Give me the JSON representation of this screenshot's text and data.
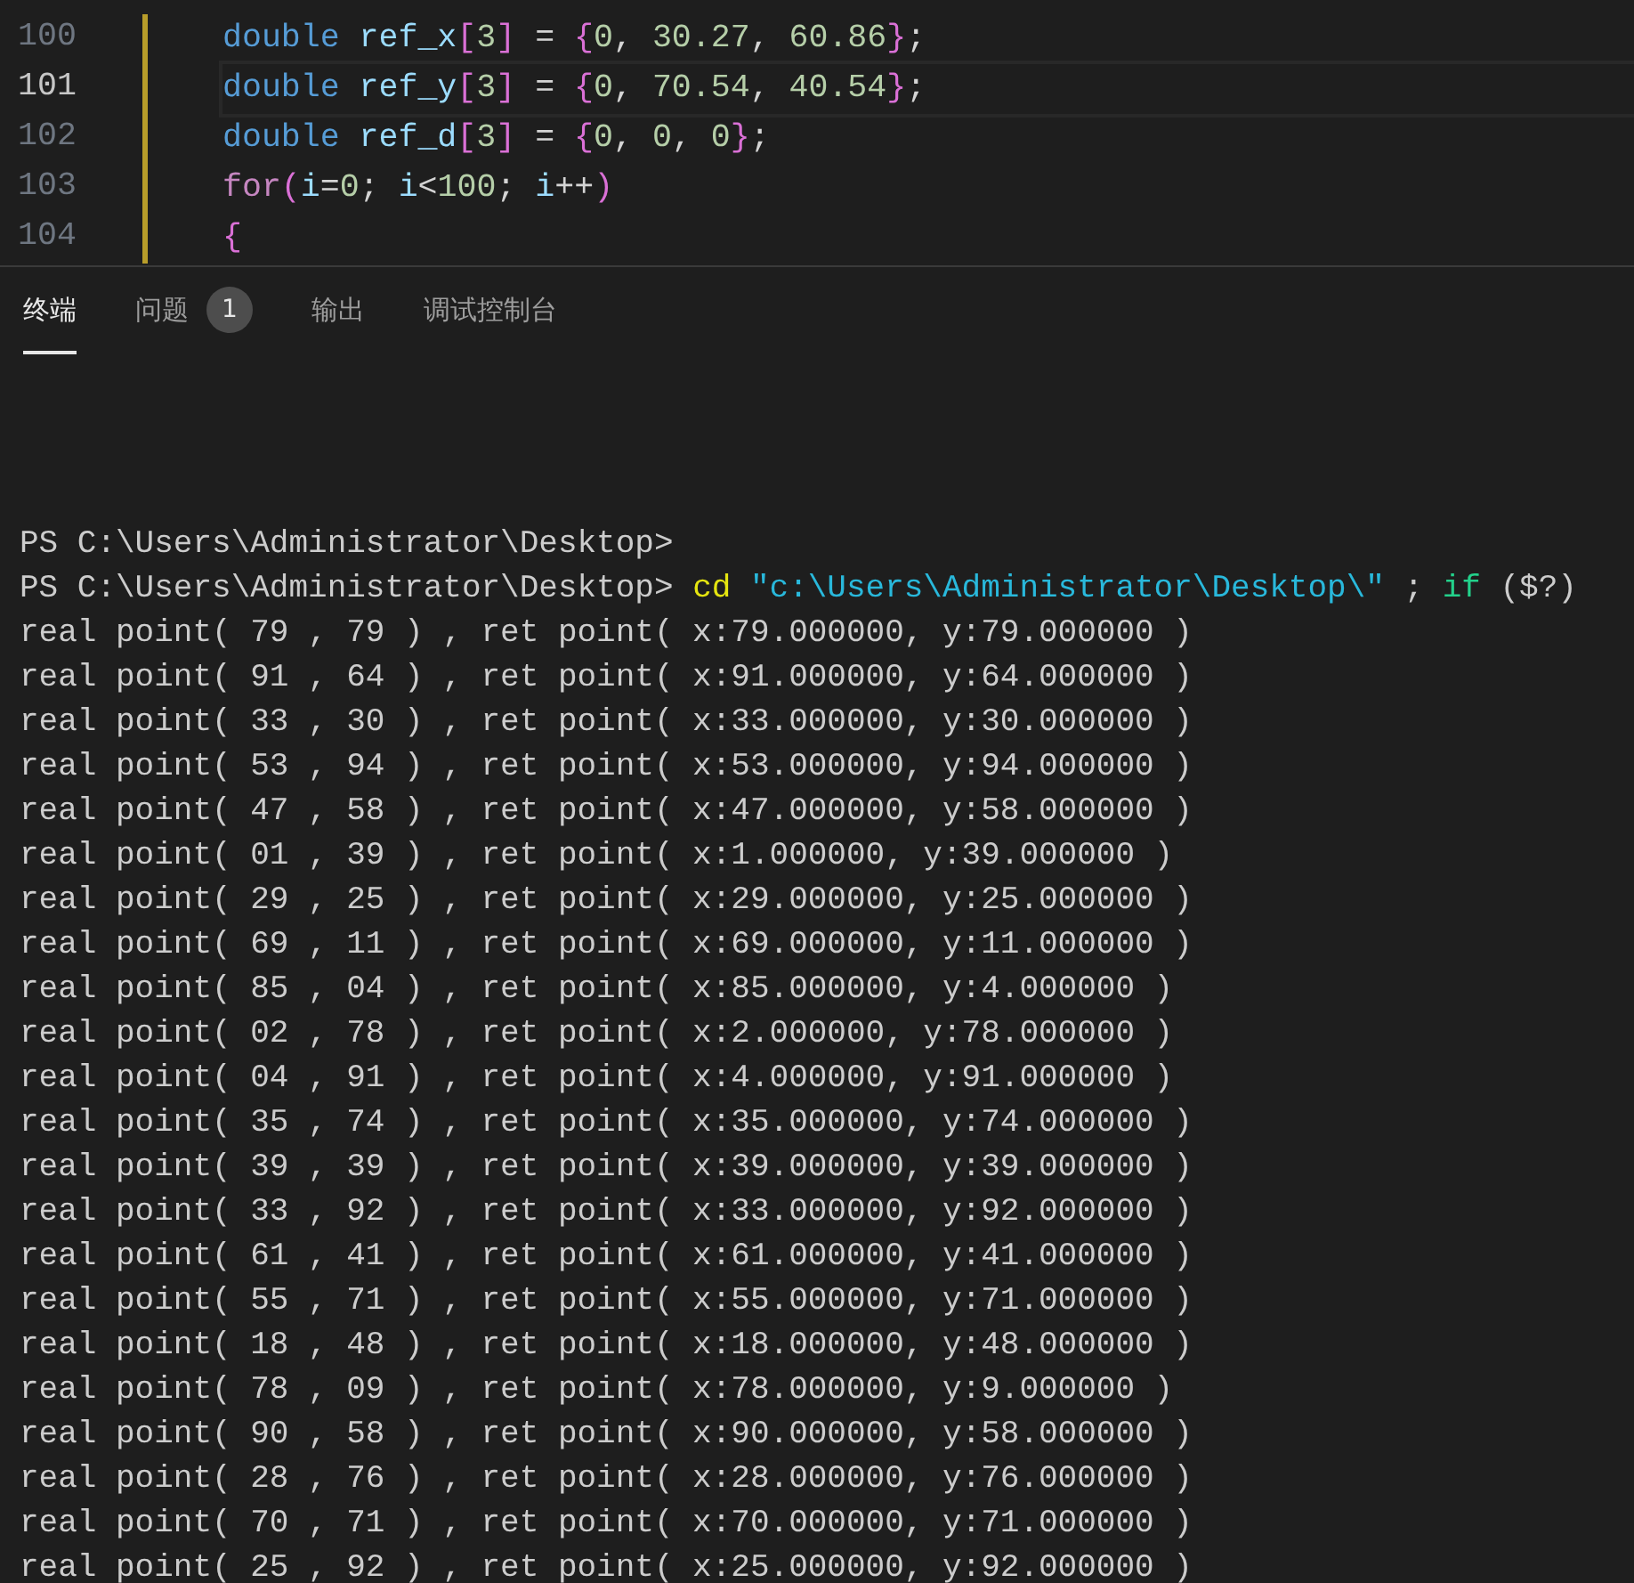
{
  "editor": {
    "lines": [
      {
        "number": "100",
        "current": false,
        "tokens": [
          {
            "kind": "type",
            "text": "double "
          },
          {
            "kind": "variable",
            "text": "ref_x"
          },
          {
            "kind": "bracket",
            "text": "["
          },
          {
            "kind": "number",
            "text": "3"
          },
          {
            "kind": "bracket",
            "text": "]"
          },
          {
            "kind": "plain",
            "text": " = "
          },
          {
            "kind": "bracket",
            "text": "{"
          },
          {
            "kind": "number",
            "text": "0"
          },
          {
            "kind": "plain",
            "text": ", "
          },
          {
            "kind": "number",
            "text": "30.27"
          },
          {
            "kind": "plain",
            "text": ", "
          },
          {
            "kind": "number",
            "text": "60.86"
          },
          {
            "kind": "bracket",
            "text": "}"
          },
          {
            "kind": "plain",
            "text": ";"
          }
        ]
      },
      {
        "number": "101",
        "current": true,
        "tokens": [
          {
            "kind": "type",
            "text": "double "
          },
          {
            "kind": "variable",
            "text": "ref_y"
          },
          {
            "kind": "bracket",
            "text": "["
          },
          {
            "kind": "number",
            "text": "3"
          },
          {
            "kind": "bracket",
            "text": "]"
          },
          {
            "kind": "plain",
            "text": " = "
          },
          {
            "kind": "bracket",
            "text": "{"
          },
          {
            "kind": "number",
            "text": "0"
          },
          {
            "kind": "plain",
            "text": ", "
          },
          {
            "kind": "number",
            "text": "70.54"
          },
          {
            "kind": "plain",
            "text": ", "
          },
          {
            "kind": "number",
            "text": "40.54"
          },
          {
            "kind": "bracket",
            "text": "}"
          },
          {
            "kind": "plain",
            "text": ";"
          }
        ]
      },
      {
        "number": "102",
        "current": false,
        "tokens": [
          {
            "kind": "type",
            "text": "double "
          },
          {
            "kind": "variable",
            "text": "ref_d"
          },
          {
            "kind": "bracket",
            "text": "["
          },
          {
            "kind": "number",
            "text": "3"
          },
          {
            "kind": "bracket",
            "text": "]"
          },
          {
            "kind": "plain",
            "text": " = "
          },
          {
            "kind": "bracket",
            "text": "{"
          },
          {
            "kind": "number",
            "text": "0"
          },
          {
            "kind": "plain",
            "text": ", "
          },
          {
            "kind": "number",
            "text": "0"
          },
          {
            "kind": "plain",
            "text": ", "
          },
          {
            "kind": "number",
            "text": "0"
          },
          {
            "kind": "bracket",
            "text": "}"
          },
          {
            "kind": "plain",
            "text": ";"
          }
        ]
      },
      {
        "number": "103",
        "current": false,
        "tokens": [
          {
            "kind": "keyword",
            "text": "for"
          },
          {
            "kind": "bracket",
            "text": "("
          },
          {
            "kind": "variable",
            "text": "i"
          },
          {
            "kind": "plain",
            "text": "="
          },
          {
            "kind": "number",
            "text": "0"
          },
          {
            "kind": "plain",
            "text": "; "
          },
          {
            "kind": "variable",
            "text": "i"
          },
          {
            "kind": "plain",
            "text": "<"
          },
          {
            "kind": "number",
            "text": "100"
          },
          {
            "kind": "plain",
            "text": "; "
          },
          {
            "kind": "variable",
            "text": "i"
          },
          {
            "kind": "plain",
            "text": "++"
          },
          {
            "kind": "bracket",
            "text": ")"
          }
        ]
      },
      {
        "number": "104",
        "current": false,
        "tokens": [
          {
            "kind": "bracket",
            "text": "{"
          }
        ]
      }
    ]
  },
  "panel": {
    "tabs": [
      {
        "label": "终端",
        "selected": true
      },
      {
        "label": "问题",
        "selected": false,
        "badge": "1"
      },
      {
        "label": "输出",
        "selected": false
      },
      {
        "label": "调试控制台",
        "selected": false
      }
    ]
  },
  "terminal": {
    "lines": [
      [
        {
          "kind": "plain",
          "text": "PS C:\\Users\\Administrator\\Desktop>"
        }
      ],
      [
        {
          "kind": "plain",
          "text": "PS C:\\Users\\Administrator\\Desktop> "
        },
        {
          "kind": "command",
          "text": "cd "
        },
        {
          "kind": "string",
          "text": "\"c:\\Users\\Administrator\\Desktop\\\""
        },
        {
          "kind": "plain",
          "text": " ; "
        },
        {
          "kind": "keyword",
          "text": "if"
        },
        {
          "kind": "plain",
          "text": " ($?)"
        }
      ],
      [
        {
          "kind": "plain",
          "text": "real point( 79 , 79 ) , ret point( x:79.000000, y:79.000000 )"
        }
      ],
      [
        {
          "kind": "plain",
          "text": "real point( 91 , 64 ) , ret point( x:91.000000, y:64.000000 )"
        }
      ],
      [
        {
          "kind": "plain",
          "text": "real point( 33 , 30 ) , ret point( x:33.000000, y:30.000000 )"
        }
      ],
      [
        {
          "kind": "plain",
          "text": "real point( 53 , 94 ) , ret point( x:53.000000, y:94.000000 )"
        }
      ],
      [
        {
          "kind": "plain",
          "text": "real point( 47 , 58 ) , ret point( x:47.000000, y:58.000000 )"
        }
      ],
      [
        {
          "kind": "plain",
          "text": "real point( 01 , 39 ) , ret point( x:1.000000, y:39.000000 )"
        }
      ],
      [
        {
          "kind": "plain",
          "text": "real point( 29 , 25 ) , ret point( x:29.000000, y:25.000000 )"
        }
      ],
      [
        {
          "kind": "plain",
          "text": "real point( 69 , 11 ) , ret point( x:69.000000, y:11.000000 )"
        }
      ],
      [
        {
          "kind": "plain",
          "text": "real point( 85 , 04 ) , ret point( x:85.000000, y:4.000000 )"
        }
      ],
      [
        {
          "kind": "plain",
          "text": "real point( 02 , 78 ) , ret point( x:2.000000, y:78.000000 )"
        }
      ],
      [
        {
          "kind": "plain",
          "text": "real point( 04 , 91 ) , ret point( x:4.000000, y:91.000000 )"
        }
      ],
      [
        {
          "kind": "plain",
          "text": "real point( 35 , 74 ) , ret point( x:35.000000, y:74.000000 )"
        }
      ],
      [
        {
          "kind": "plain",
          "text": "real point( 39 , 39 ) , ret point( x:39.000000, y:39.000000 )"
        }
      ],
      [
        {
          "kind": "plain",
          "text": "real point( 33 , 92 ) , ret point( x:33.000000, y:92.000000 )"
        }
      ],
      [
        {
          "kind": "plain",
          "text": "real point( 61 , 41 ) , ret point( x:61.000000, y:41.000000 )"
        }
      ],
      [
        {
          "kind": "plain",
          "text": "real point( 55 , 71 ) , ret point( x:55.000000, y:71.000000 )"
        }
      ],
      [
        {
          "kind": "plain",
          "text": "real point( 18 , 48 ) , ret point( x:18.000000, y:48.000000 )"
        }
      ],
      [
        {
          "kind": "plain",
          "text": "real point( 78 , 09 ) , ret point( x:78.000000, y:9.000000 )"
        }
      ],
      [
        {
          "kind": "plain",
          "text": "real point( 90 , 58 ) , ret point( x:90.000000, y:58.000000 )"
        }
      ],
      [
        {
          "kind": "plain",
          "text": "real point( 28 , 76 ) , ret point( x:28.000000, y:76.000000 )"
        }
      ],
      [
        {
          "kind": "plain",
          "text": "real point( 70 , 71 ) , ret point( x:70.000000, y:71.000000 )"
        }
      ],
      [
        {
          "kind": "plain",
          "text": "real point( 25 , 92 ) , ret point( x:25.000000, y:92.000000 )"
        }
      ]
    ]
  }
}
